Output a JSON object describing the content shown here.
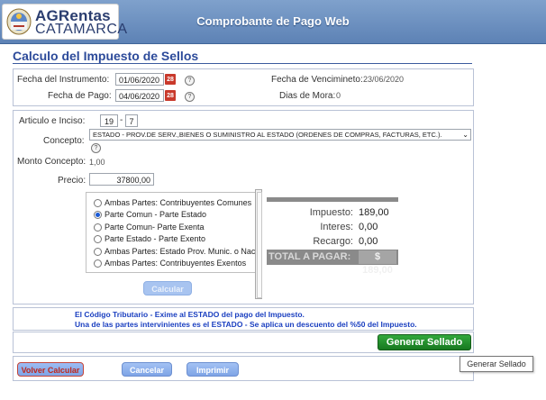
{
  "header": {
    "logo_line1": "AGRentas",
    "logo_line2": "CATAMARCA",
    "title": "Comprobante de Pago Web"
  },
  "page_title": "Calculo del Impuesto de Sellos",
  "fechas": {
    "instrumento_label": "Fecha del Instrumento:",
    "instrumento_value": "01/06/2020",
    "pago_label": "Fecha de Pago:",
    "pago_value": "04/06/2020",
    "vencimiento_label": "Fecha de Vencimineto:",
    "vencimiento_value": "23/06/2020",
    "mora_label": "Dias de Mora:",
    "mora_value": "0",
    "calendar_glyph": "28",
    "help_glyph": "?"
  },
  "concepto": {
    "articulo_label": "Articulo e Inciso:",
    "articulo_value": "19",
    "separator": "-",
    "inciso_value": "7",
    "concepto_label": "Concepto:",
    "concepto_value": "ESTADO - PROV.DE SERV.,BIENES O SUMINISTRO AL ESTADO (ORDENES DE COMPRAS, FACTURAS, ETC.).",
    "monto_label": "Monto Concepto:",
    "monto_value": "1,00",
    "precio_label": "Precio:",
    "precio_value": "37800,00"
  },
  "partes": {
    "options": [
      "Ambas Partes: Contribuyentes Comunes",
      "Parte Comun - Parte Estado",
      "Parte Comun- Parte Exenta",
      "Parte Estado - Parte Exento",
      "Ambas Partes: Estado Prov. Munic. o Nac.",
      "Ambas Partes: Contribuyentes Exentos"
    ],
    "selected_index": 1,
    "calcular_label": "Calcular"
  },
  "resultado": {
    "impuesto_label": "Impuesto:",
    "impuesto_value": "189,00",
    "intereses_label": "Interes:",
    "intereses_value": "0,00",
    "recargo_label": "Recargo:",
    "recargo_value": "0,00",
    "total_label": "TOTAL A PAGAR:",
    "total_value": "$ 189,00"
  },
  "mensajes": {
    "line1": "El Código Tributario - Exime al ESTADO del pago del Impuesto.",
    "line2": "Una de las partes intervinientes es el ESTADO - Se aplica un descuento del %50 del Impuesto."
  },
  "acciones": {
    "generar_label": "Generar Sellado",
    "tooltip": "Generar Sellado",
    "volver_label": "Volver Calcular",
    "cancelar_label": "Cancelar",
    "imprimir_label": "Imprimir"
  },
  "colors": {
    "header_blue": "#6a8fc2",
    "title_blue": "#2c4a9a",
    "message_blue": "#1a3fc0",
    "generar_green": "#1f8a2a",
    "total_gray": "#8a8a8a"
  }
}
